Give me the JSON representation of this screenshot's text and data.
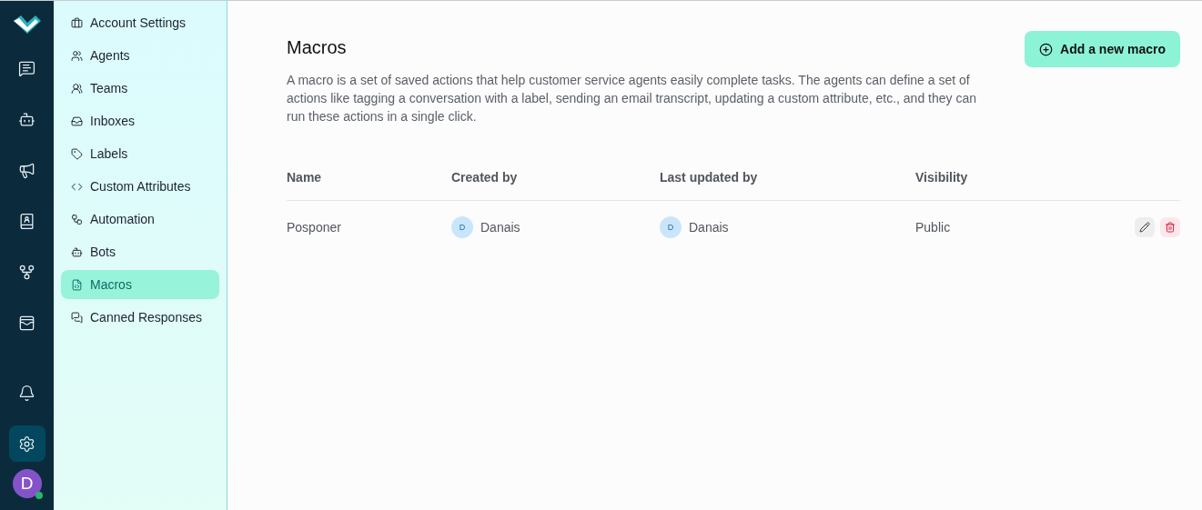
{
  "rail": {
    "items": [
      {
        "selected": false
      },
      {
        "selected": false
      },
      {
        "selected": false
      },
      {
        "selected": false
      },
      {
        "selected": false
      },
      {
        "selected": false
      }
    ],
    "bottom": [
      {
        "selected": false
      },
      {
        "selected": true
      }
    ],
    "avatar": {
      "initial": "D",
      "online": true
    }
  },
  "settings_nav": [
    {
      "label": "Account Settings",
      "selected": false
    },
    {
      "label": "Agents",
      "selected": false
    },
    {
      "label": "Teams",
      "selected": false
    },
    {
      "label": "Inboxes",
      "selected": false
    },
    {
      "label": "Labels",
      "selected": false
    },
    {
      "label": "Custom Attributes",
      "selected": false
    },
    {
      "label": "Automation",
      "selected": false
    },
    {
      "label": "Bots",
      "selected": false
    },
    {
      "label": "Macros",
      "selected": true
    },
    {
      "label": "Canned Responses",
      "selected": false
    }
  ],
  "page": {
    "title": "Macros",
    "description": "A macro is a set of saved actions that help customer service agents easily complete tasks. The agents can define a set of actions like tagging a conversation with a label, sending an email transcript, updating a custom attribute, etc., and they can run these actions in a single click.",
    "add_button": "Add a new macro"
  },
  "table": {
    "columns": [
      "Name",
      "Created by",
      "Last updated by",
      "Visibility"
    ],
    "rows": [
      {
        "name": "Posponer",
        "created_by": {
          "initial": "D",
          "name": "Danais"
        },
        "updated_by": {
          "initial": "D",
          "name": "Danais"
        },
        "visibility": "Public"
      }
    ]
  }
}
